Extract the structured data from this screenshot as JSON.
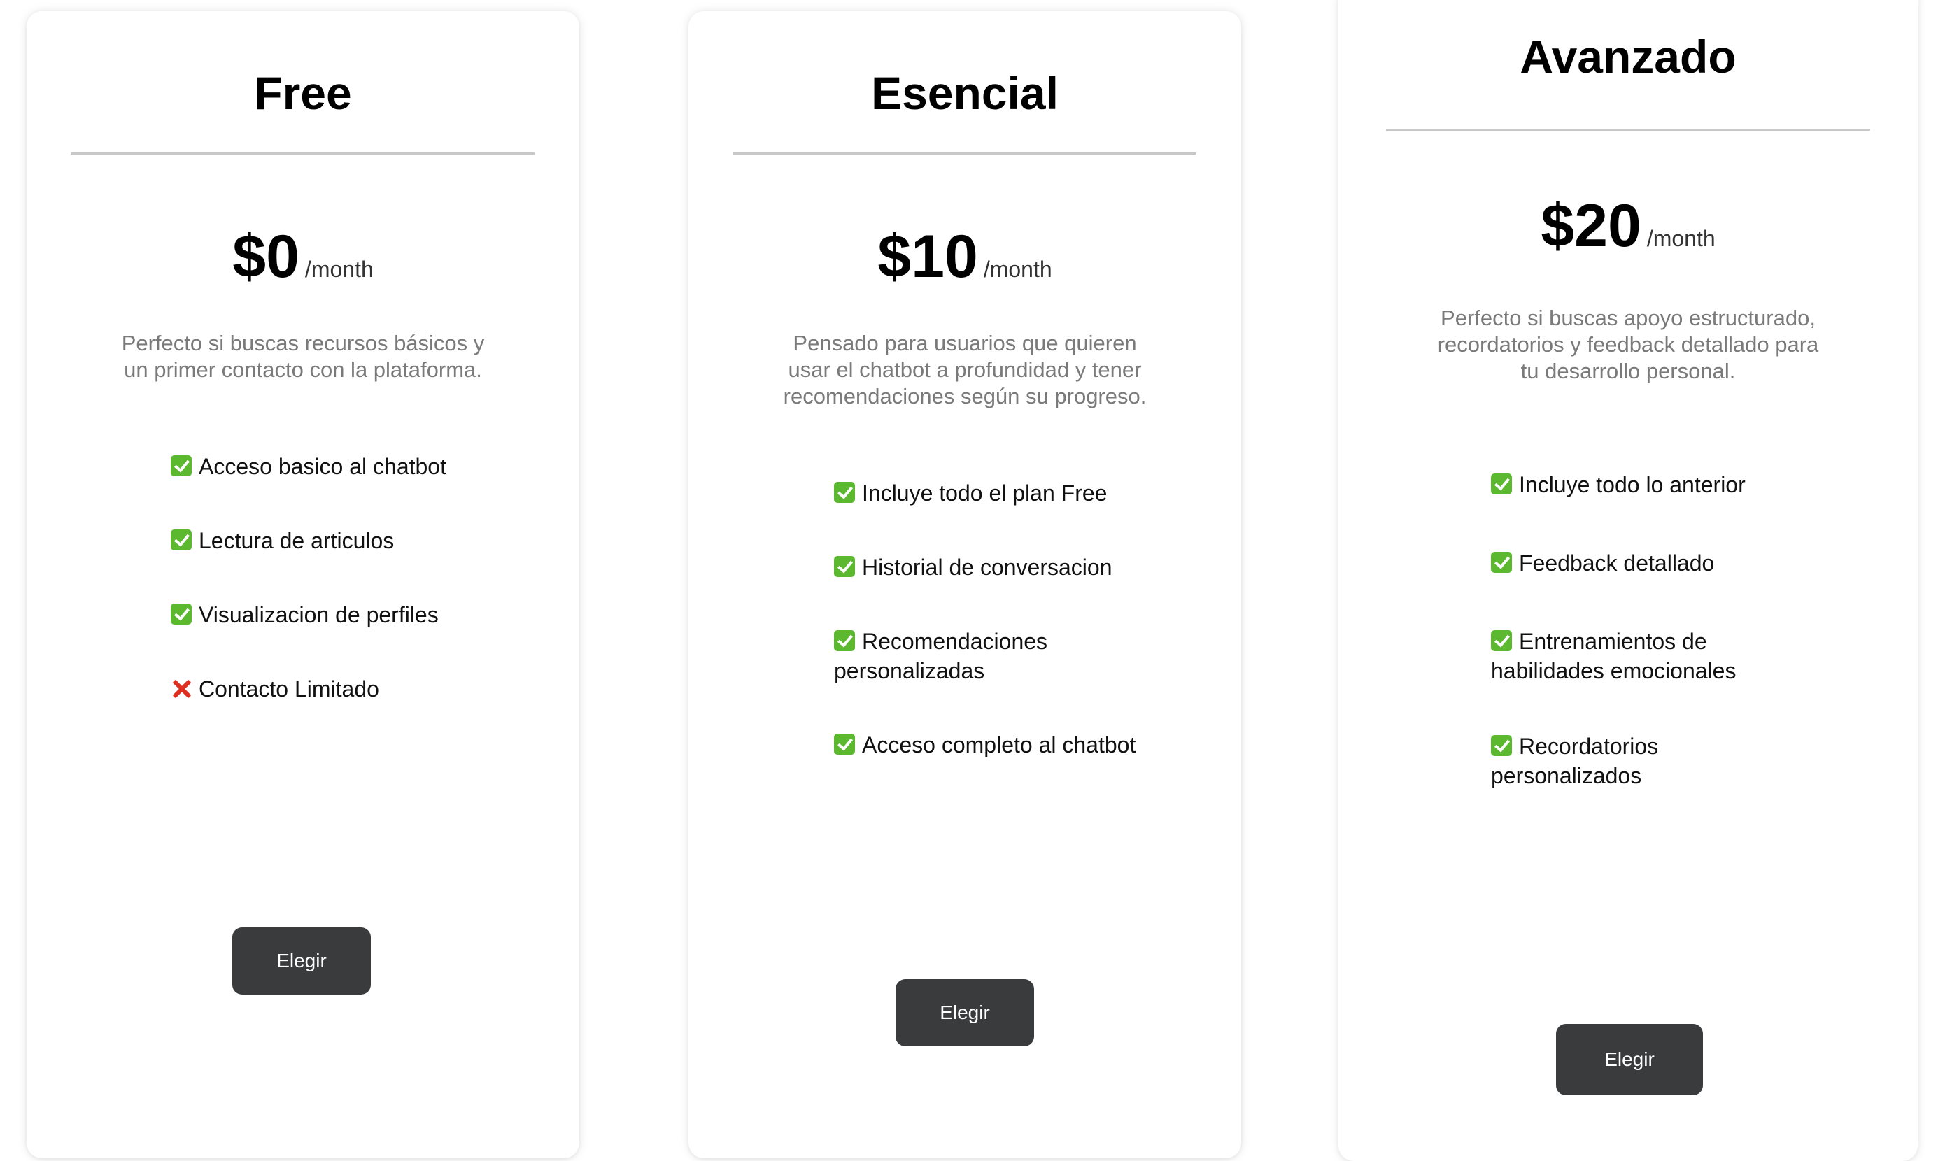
{
  "plans": [
    {
      "name": "Free",
      "price": "$0",
      "period": "/month",
      "description": "Perfecto si buscas recursos básicos y un primer contacto con la plataforma.",
      "features": [
        {
          "status": "check",
          "icon": "check-icon",
          "text": "Acceso basico al chatbot"
        },
        {
          "status": "check",
          "icon": "check-icon",
          "text": "Lectura de articulos"
        },
        {
          "status": "check",
          "icon": "check-icon",
          "text": "Visualizacion de perfiles"
        },
        {
          "status": "cross",
          "icon": "cross-icon",
          "text": "Contacto Limitado"
        }
      ],
      "button_label": "Elegir"
    },
    {
      "name": "Esencial",
      "price": "$10",
      "period": "/month",
      "description": "Pensado para usuarios que quieren usar el chatbot a profundidad y tener recomendaciones según su progreso.",
      "features": [
        {
          "status": "check",
          "icon": "check-icon",
          "text": "Incluye todo el plan Free"
        },
        {
          "status": "check",
          "icon": "check-icon",
          "text": "Historial de conversacion"
        },
        {
          "status": "check",
          "icon": "check-icon",
          "text": "Recomendaciones personalizadas"
        },
        {
          "status": "check",
          "icon": "check-icon",
          "text": "Acceso completo al chatbot"
        }
      ],
      "button_label": "Elegir"
    },
    {
      "name": "Avanzado",
      "price": "$20",
      "period": "/month",
      "description": "Perfecto si buscas apoyo estructurado, recordatorios y feedback detallado para tu desarrollo personal.",
      "features": [
        {
          "status": "check",
          "icon": "check-icon",
          "text": "Incluye todo lo anterior"
        },
        {
          "status": "check",
          "icon": "check-icon",
          "text": "Feedback detallado"
        },
        {
          "status": "check",
          "icon": "check-icon",
          "text": "Entrenamientos de habilidades emocionales"
        },
        {
          "status": "check",
          "icon": "check-icon",
          "text": "Recordatorios personalizados"
        }
      ],
      "button_label": "Elegir"
    }
  ],
  "colors": {
    "button_background": "#3a3b3d",
    "check_green": "#5cb82e",
    "cross_red": "#dd2e1f",
    "description_gray": "#7a7a7a"
  }
}
